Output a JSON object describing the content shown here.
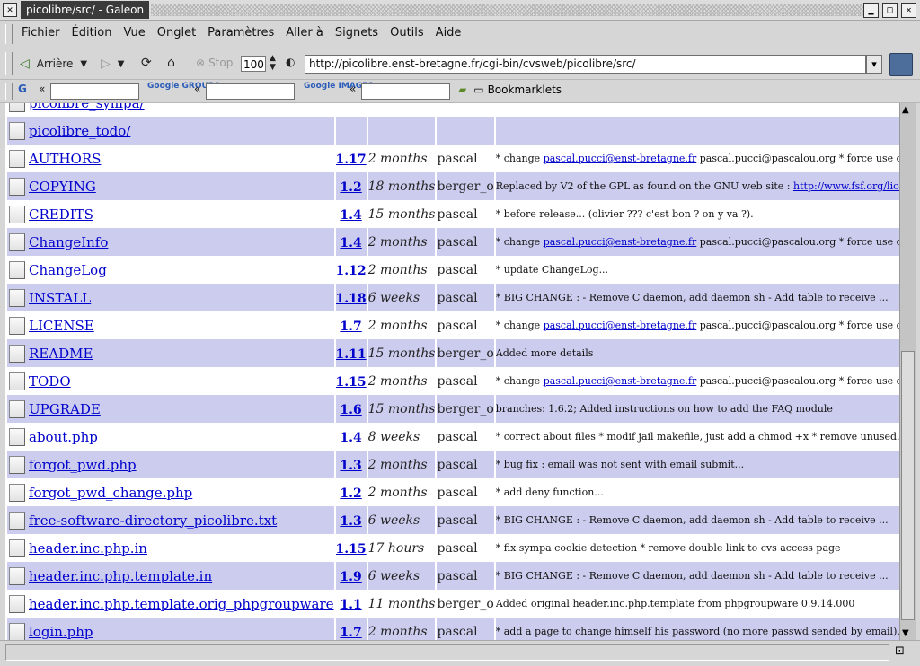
{
  "window": {
    "title": "picolibre/src/ - Galeon"
  },
  "menu": [
    "Fichier",
    "Édition",
    "Vue",
    "Onglet",
    "Paramètres",
    "Aller à",
    "Signets",
    "Outils",
    "Aide"
  ],
  "toolbar": {
    "back_label": "Arrière",
    "stop_label": "Stop",
    "zoom_value": "100",
    "url": "http://picolibre.enst-bretagne.fr/cgi-bin/cvsweb/picolibre/src/"
  },
  "searchbar": {
    "google_label": "G",
    "groups_label": "Google GROUPS",
    "images_label": "Google IMAGES",
    "arrow": "«",
    "bookmarklets_label": "Bookmarklets"
  },
  "rows": [
    {
      "name": "picolibre_sympa/",
      "rev": "",
      "age": "",
      "author": "",
      "log": ""
    },
    {
      "name": "picolibre_todo/",
      "rev": "",
      "age": "",
      "author": "",
      "log": ""
    },
    {
      "name": "AUTHORS",
      "rev": "1.17",
      "age": "2 months",
      "author": "pascal",
      "log_pre": "* change ",
      "log_link": "pascal.pucci@enst-bretagne.fr",
      "log_post": " pascal.pucci@pascalou.org * force use dc=..."
    },
    {
      "name": "COPYING",
      "rev": "1.2",
      "age": "18 months",
      "author": "berger_o",
      "log_pre": "Replaced by V2 of the GPL as found on the GNU web site : ",
      "log_link": "http://www.fsf.org/lice...",
      "log_post": ""
    },
    {
      "name": "CREDITS",
      "rev": "1.4",
      "age": "15 months",
      "author": "pascal",
      "log": "* before release... (olivier ??? c'est bon ? on y va ?)."
    },
    {
      "name": "ChangeInfo",
      "rev": "1.4",
      "age": "2 months",
      "author": "pascal",
      "log_pre": "* change ",
      "log_link": "pascal.pucci@enst-bretagne.fr",
      "log_post": " pascal.pucci@pascalou.org * force use dc=..."
    },
    {
      "name": "ChangeLog",
      "rev": "1.12",
      "age": "2 months",
      "author": "pascal",
      "log": "* update ChangeLog..."
    },
    {
      "name": "INSTALL",
      "rev": "1.18",
      "age": "6 weeks",
      "author": "pascal",
      "log": "* BIG CHANGE : - Remove C daemon, add daemon sh - Add table to receive ..."
    },
    {
      "name": "LICENSE",
      "rev": "1.7",
      "age": "2 months",
      "author": "pascal",
      "log_pre": "* change ",
      "log_link": "pascal.pucci@enst-bretagne.fr",
      "log_post": " pascal.pucci@pascalou.org * force use dc=..."
    },
    {
      "name": "README",
      "rev": "1.11",
      "age": "15 months",
      "author": "berger_o",
      "log": "Added more details"
    },
    {
      "name": "TODO",
      "rev": "1.15",
      "age": "2 months",
      "author": "pascal",
      "log_pre": "* change ",
      "log_link": "pascal.pucci@enst-bretagne.fr",
      "log_post": " pascal.pucci@pascalou.org * force use dc=..."
    },
    {
      "name": "UPGRADE",
      "rev": "1.6",
      "age": "15 months",
      "author": "berger_o",
      "log": "branches: 1.6.2; Added instructions on how to add the FAQ module"
    },
    {
      "name": "about.php",
      "rev": "1.4",
      "age": "8 weeks",
      "author": "pascal",
      "log": "* correct about files * modif jail makefile, just add a chmod +x * remove unused..."
    },
    {
      "name": "forgot_pwd.php",
      "rev": "1.3",
      "age": "2 months",
      "author": "pascal",
      "log": "* bug fix : email was not sent with email submit..."
    },
    {
      "name": "forgot_pwd_change.php",
      "rev": "1.2",
      "age": "2 months",
      "author": "pascal",
      "log": "* add deny function..."
    },
    {
      "name": "free-software-directory_picolibre.txt",
      "rev": "1.3",
      "age": "6 weeks",
      "author": "pascal",
      "log": "* BIG CHANGE : - Remove C daemon, add daemon sh - Add table to receive ..."
    },
    {
      "name": "header.inc.php.in",
      "rev": "1.15",
      "age": "17 hours",
      "author": "pascal",
      "log": "* fix sympa cookie detection * remove double link to cvs access page"
    },
    {
      "name": "header.inc.php.template.in",
      "rev": "1.9",
      "age": "6 weeks",
      "author": "pascal",
      "log": "* BIG CHANGE : - Remove C daemon, add daemon sh - Add table to receive ..."
    },
    {
      "name": "header.inc.php.template.orig_phpgroupware",
      "rev": "1.1",
      "age": "11 months",
      "author": "berger_o",
      "log": "Added original header.inc.php.template from phpgroupware 0.9.14.000"
    },
    {
      "name": "login.php",
      "rev": "1.7",
      "age": "2 months",
      "author": "pascal",
      "log": "* add a page to change himself his password (no more passwd sended by email)..."
    }
  ]
}
